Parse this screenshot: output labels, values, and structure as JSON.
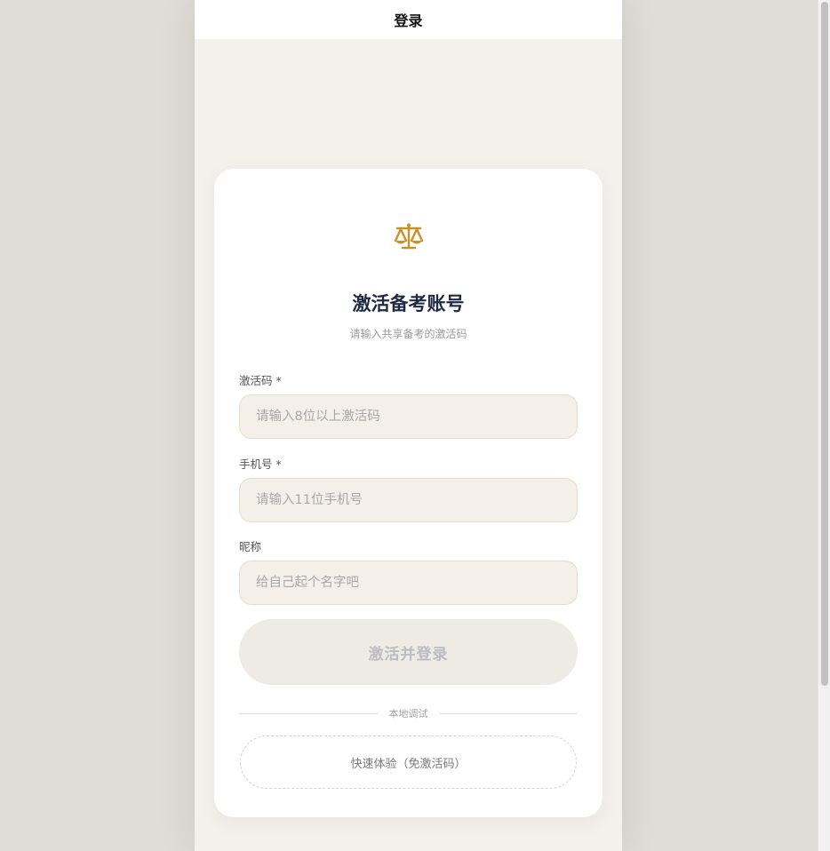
{
  "header": {
    "title": "登录"
  },
  "card": {
    "logo_icon": "scales-icon",
    "title": "激活备考账号",
    "subtitle": "请输入共享备考的激活码"
  },
  "form": {
    "activation_code": {
      "label": "激活码",
      "required_mark": "*",
      "placeholder": "请输入8位以上激活码",
      "value": ""
    },
    "phone": {
      "label": "手机号",
      "required_mark": "*",
      "placeholder": "请输入11位手机号",
      "value": ""
    },
    "nickname": {
      "label": "昵称",
      "placeholder": "给自己起个名字吧",
      "value": ""
    },
    "submit_label": "激活并登录"
  },
  "debug": {
    "divider_label": "本地调试",
    "quick_label": "快速体验（免激活码）"
  },
  "colors": {
    "accent": "#c8922a",
    "title": "#1e2a44",
    "page_bg": "#f4f1ec",
    "outer_bg": "#e0dcd6"
  }
}
